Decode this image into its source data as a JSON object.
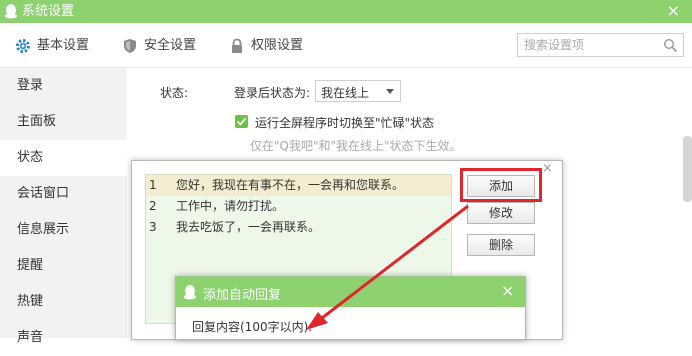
{
  "window": {
    "title": "系统设置",
    "close": "×"
  },
  "nav": {
    "tabs": [
      {
        "label": "基本设置",
        "icon": "gear-icon"
      },
      {
        "label": "安全设置",
        "icon": "shield-icon"
      },
      {
        "label": "权限设置",
        "icon": "lock-icon"
      }
    ],
    "search_placeholder": "搜索设置项"
  },
  "sidebar": {
    "items": [
      {
        "label": "登录"
      },
      {
        "label": "主面板"
      },
      {
        "label": "状态"
      },
      {
        "label": "会话窗口"
      },
      {
        "label": "信息展示"
      },
      {
        "label": "提醒"
      },
      {
        "label": "热键"
      },
      {
        "label": "声音"
      }
    ],
    "active": "状态"
  },
  "status_settings": {
    "label": "状态:",
    "after_login_label": "登录后状态为:",
    "after_login_value": "我在线上",
    "fullscreen_checkbox_label": "运行全屏程序时切换至\"忙碌\"状态",
    "fullscreen_checked": true,
    "hint": "仅在\"Q我吧\"和\"我在线上\"状态下生效。"
  },
  "auto_reply": {
    "rows": [
      {
        "num": "1",
        "text": "您好，我现在有事不在，一会再和您联系。",
        "selected": true
      },
      {
        "num": "2",
        "text": "工作中，请勿打扰。",
        "selected": false
      },
      {
        "num": "3",
        "text": "我去吃饭了，一会再联系。",
        "selected": false
      }
    ],
    "buttons": {
      "add": "添加",
      "edit": "修改",
      "delete": "删除"
    },
    "close": "×"
  },
  "add_dialog": {
    "title": "添加自动回复",
    "close": "×",
    "content_label": "回复内容(100字以内):"
  },
  "colors": {
    "accent_green": "#8ed16f",
    "annotation_red": "#e0262c",
    "selected_row": "#f4ecd0"
  }
}
